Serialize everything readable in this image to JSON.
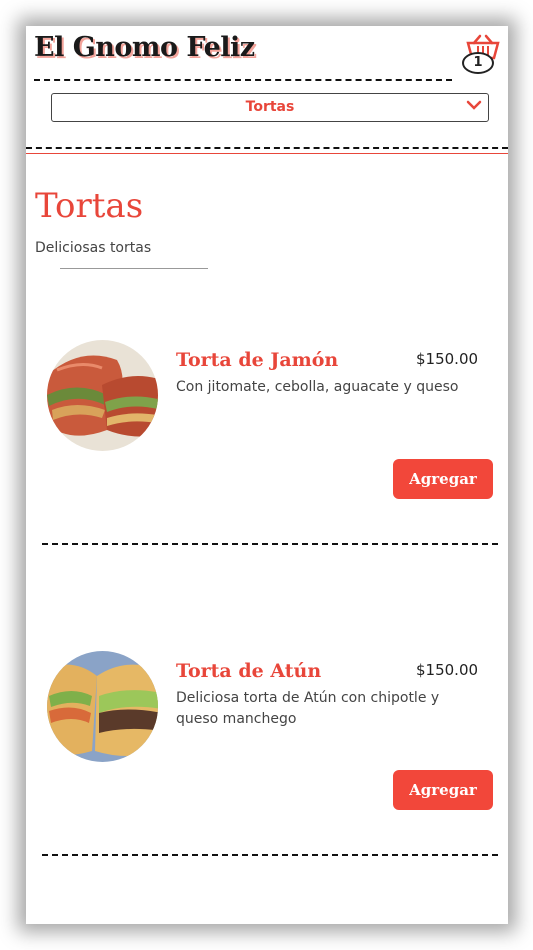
{
  "header": {
    "brand": "El Gnomo Feliz",
    "cart_count": "1",
    "cart_icon": "basket-icon"
  },
  "category_select": {
    "selected": "Tortas",
    "chevron_icon": "chevron-down-icon"
  },
  "section": {
    "title": "Tortas",
    "subtitle": "Deliciosas tortas"
  },
  "products": [
    {
      "name": "Torta de Jamón",
      "price": "$150.00",
      "description": "Con jitomate, cebolla, aguacate y queso",
      "button": "Agregar"
    },
    {
      "name": "Torta de Atún",
      "price": "$150.00",
      "description": "Deliciosa torta de Atún con chipotle y queso manchego",
      "button": "Agregar"
    }
  ],
  "colors": {
    "accent": "#e8463a",
    "button": "#f2473a",
    "text": "#444444"
  }
}
